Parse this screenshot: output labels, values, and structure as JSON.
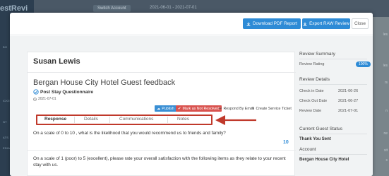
{
  "background": {
    "brand": "estRevi",
    "nav_items": [
      "BO",
      "ICKETS",
      "NT",
      "ATS",
      "EDIA"
    ],
    "switch_label": "Switch Account",
    "date_range": "2021-06-01 - 2021-07-01",
    "right_col": [
      "les",
      "les",
      "rs",
      "n",
      "ne",
      "sit",
      "s"
    ]
  },
  "header": {
    "download_pdf": "Download PDF Report",
    "export_raw": "Export RAW Review",
    "close": "Close"
  },
  "review": {
    "guest_name": "Susan Lewis",
    "hotel_title": "Bergan House City Hotel Guest feedback",
    "questionnaire": "Post Stay Questionnaire",
    "date": "2021-07-01",
    "actions": {
      "publish": "Publish",
      "mark_resolved": "Mark as Not Resolved",
      "respond_email": "Respond By Email",
      "create_ticket": "Create Service Ticket"
    },
    "tabs": [
      "Response",
      "Details",
      "Communications",
      "Notes"
    ],
    "questions": [
      {
        "text": "On a scale of 0 to 10 , what is the likelihood that you would recommend us to friends and family?",
        "answer": "10"
      },
      {
        "text": "On a scale of 1 (poor) to 5 (excellent), please rate your overall satisfaction with the following items as they relate to your recent stay with us.",
        "answer": ""
      }
    ]
  },
  "summary": {
    "title": "Review Summary",
    "rating_label": "Review Rating",
    "rating_value": "100%",
    "details_title": "Review Details",
    "check_in_label": "Check in Date",
    "check_in": "2021-06-26",
    "check_out_label": "Check Out Date",
    "check_out": "2021-06-27",
    "review_date_label": "Review Date",
    "review_date": "2021-07-01",
    "status_title": "Current Guest Status",
    "status_value": "Thank You Sent",
    "account_title": "Account",
    "account_value": "Bergan House City Hotel"
  },
  "colors": {
    "primary": "#2e8bd6",
    "danger": "#d9534f",
    "highlight": "#c0392b"
  }
}
